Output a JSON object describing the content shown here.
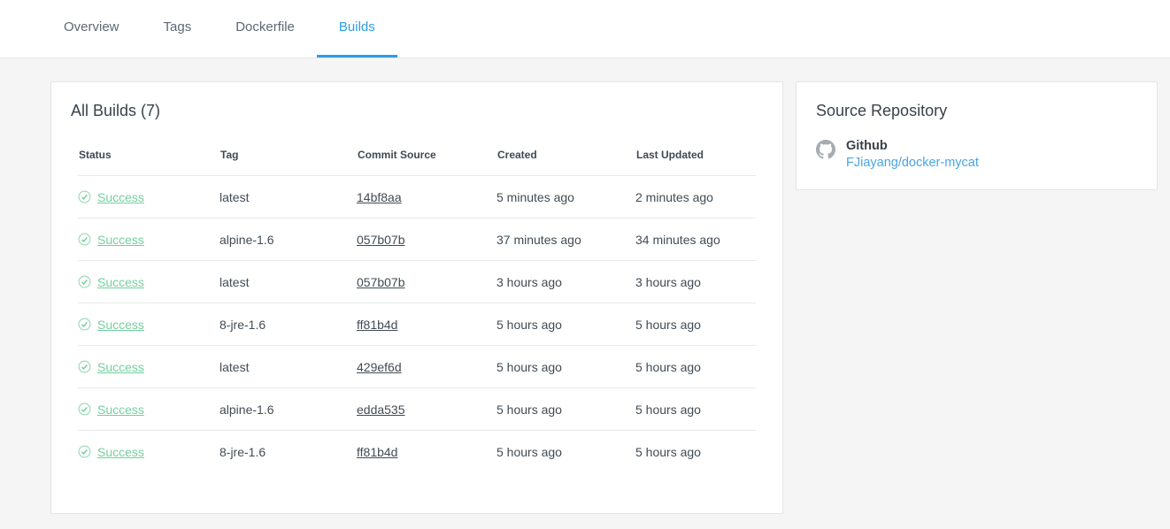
{
  "tabs": [
    {
      "label": "Overview",
      "active": false
    },
    {
      "label": "Tags",
      "active": false
    },
    {
      "label": "Dockerfile",
      "active": false
    },
    {
      "label": "Builds",
      "active": true
    }
  ],
  "builds_panel": {
    "title": "All Builds (7)",
    "columns": {
      "status": "Status",
      "tag": "Tag",
      "commit": "Commit Source",
      "created": "Created",
      "updated": "Last Updated"
    },
    "rows": [
      {
        "status": "Success",
        "tag": "latest",
        "commit": "14bf8aa",
        "created": "5 minutes ago",
        "updated": "2 minutes ago"
      },
      {
        "status": "Success",
        "tag": "alpine-1.6",
        "commit": "057b07b",
        "created": "37 minutes ago",
        "updated": "34 minutes ago"
      },
      {
        "status": "Success",
        "tag": "latest",
        "commit": "057b07b",
        "created": "3 hours ago",
        "updated": "3 hours ago"
      },
      {
        "status": "Success",
        "tag": "8-jre-1.6",
        "commit": "ff81b4d",
        "created": "5 hours ago",
        "updated": "5 hours ago"
      },
      {
        "status": "Success",
        "tag": "latest",
        "commit": "429ef6d",
        "created": "5 hours ago",
        "updated": "5 hours ago"
      },
      {
        "status": "Success",
        "tag": "alpine-1.6",
        "commit": "edda535",
        "created": "5 hours ago",
        "updated": "5 hours ago"
      },
      {
        "status": "Success",
        "tag": "8-jre-1.6",
        "commit": "ff81b4d",
        "created": "5 hours ago",
        "updated": "5 hours ago"
      }
    ]
  },
  "source_repository": {
    "title": "Source Repository",
    "provider_label": "Github",
    "repo_link": "FJiayang/docker-mycat",
    "provider_icon": "github-icon"
  },
  "icons": {
    "status_icon": "check-circle-icon"
  },
  "colors": {
    "accent_blue": "#2b9fe2",
    "success_green": "#74cf9e",
    "link_blue": "#4aa5e2",
    "page_background": "#f5f5f6"
  }
}
